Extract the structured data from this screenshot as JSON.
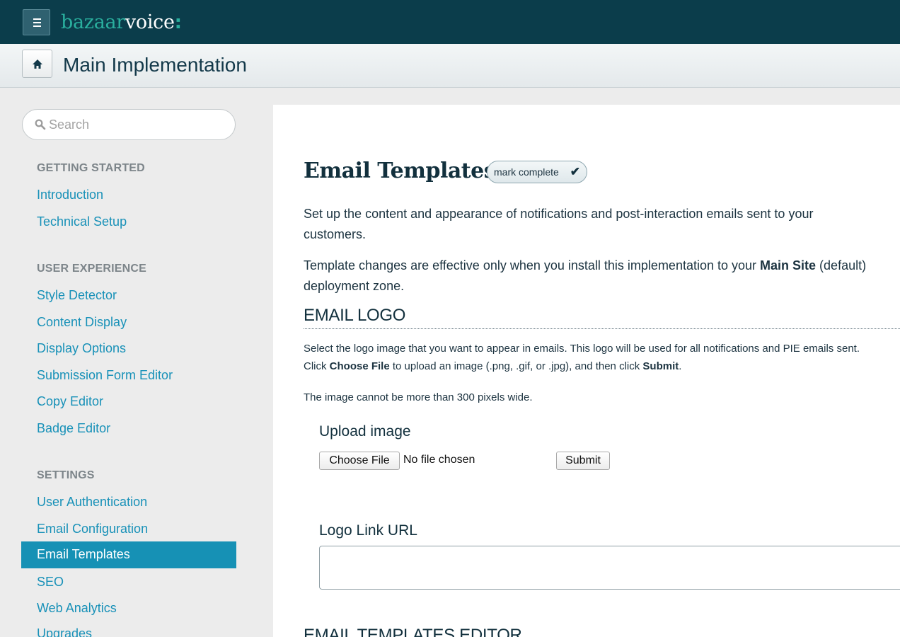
{
  "brand": {
    "logo_part1": "bazaar",
    "logo_part2": "voice",
    "logo_part3": ":"
  },
  "header": {
    "title": "Main Implementation"
  },
  "sidebar": {
    "search_placeholder": "Search",
    "sections": [
      {
        "heading": "GETTING STARTED",
        "items": [
          "Introduction",
          "Technical Setup"
        ]
      },
      {
        "heading": "USER EXPERIENCE",
        "items": [
          "Style Detector",
          "Content Display",
          "Display Options",
          "Submission Form Editor",
          "Copy Editor",
          "Badge Editor"
        ]
      },
      {
        "heading": "SETTINGS",
        "items": [
          "User Authentication",
          "Email Configuration",
          "Email Templates",
          "SEO",
          "Web Analytics",
          "Upgrades"
        ]
      }
    ],
    "active_item": "Email Templates"
  },
  "main": {
    "title": "Email Templates",
    "mark_complete": "mark complete",
    "mark_check": "✔",
    "intro": "Set up the content and appearance of notifications and post-interaction emails sent to your customers.",
    "note_pre": "Template changes are effective only when you install this implementation to your ",
    "note_bold": "Main Site",
    "note_post": " (default) deployment zone.",
    "logo_section": {
      "title": "EMAIL LOGO",
      "desc1": "Select the logo image that you want to appear in emails. This logo will be used for all notifications and PIE emails sent.",
      "desc2_pre": "Click ",
      "desc2_bold1": "Choose File",
      "desc2_mid": " to upload an image (.png, .gif, or .jpg), and then click ",
      "desc2_bold2": "Submit",
      "desc2_post": ".",
      "size_note": "The image cannot be more than 300 pixels wide.",
      "upload_label": "Upload image",
      "choose_file": "Choose File",
      "no_file": "No file chosen",
      "submit": "Submit",
      "link_url_label": "Logo Link URL",
      "link_url_value": ""
    },
    "next_section_title": "EMAIL TEMPLATES EDITOR"
  }
}
